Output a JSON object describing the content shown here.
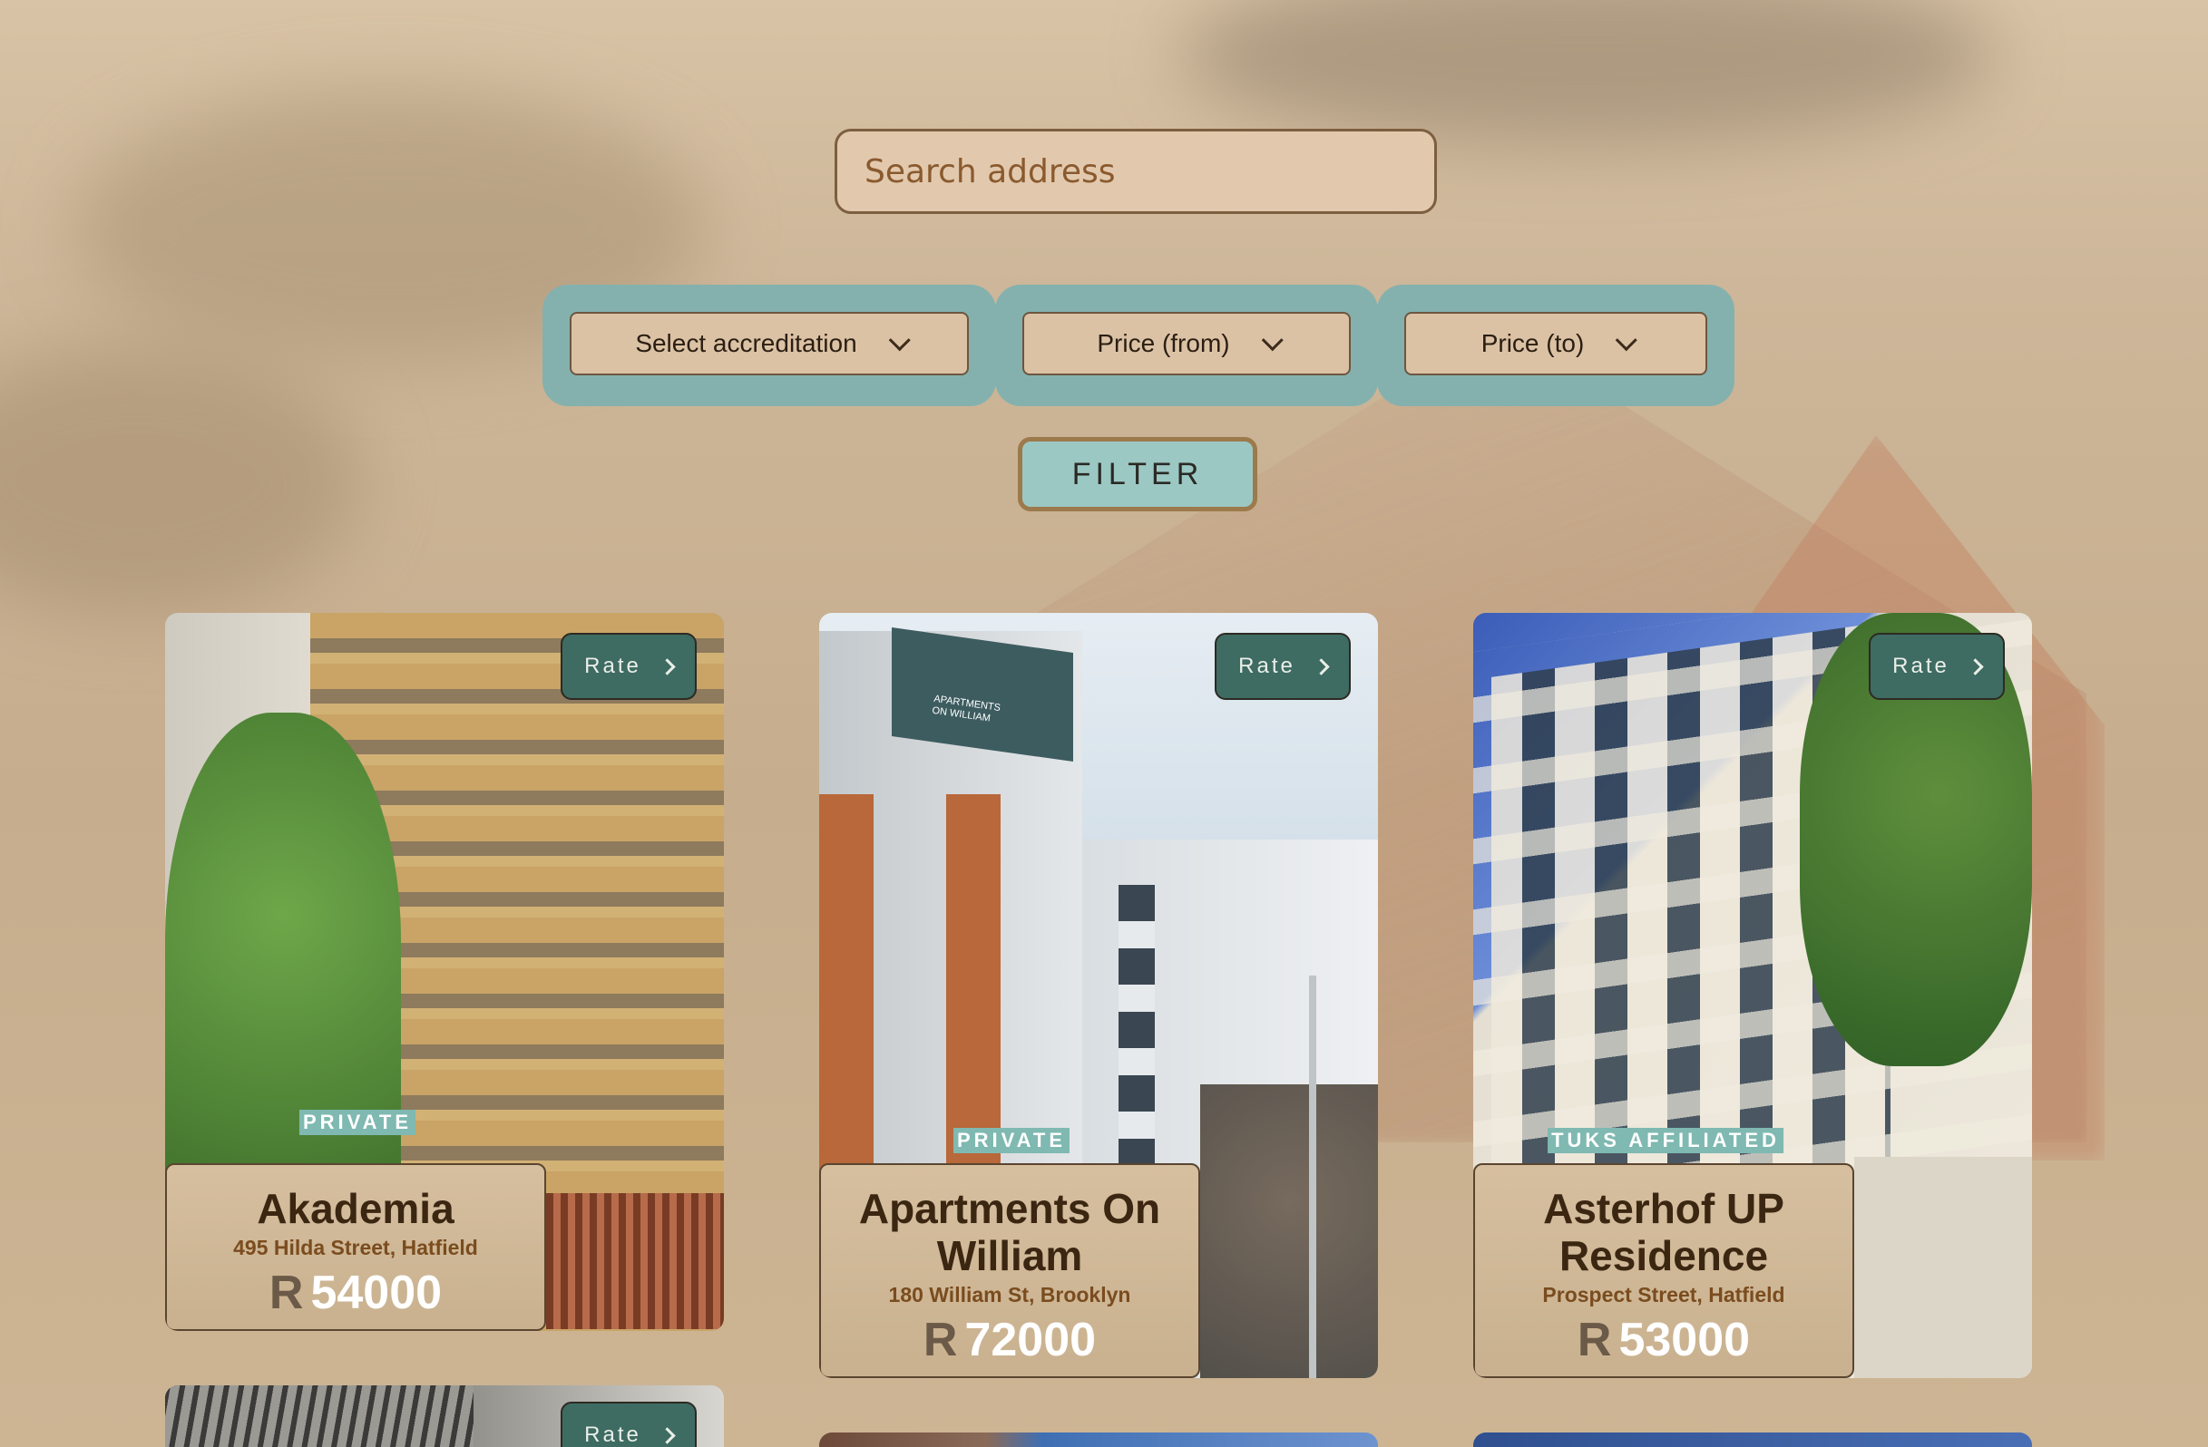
{
  "search": {
    "placeholder": "Search address"
  },
  "filters": {
    "accreditation": "Select accreditation",
    "price_from": "Price (from)",
    "price_to": "Price (to)"
  },
  "filter_button": "FILTER",
  "listings": [
    {
      "name": "Akademia",
      "address": "495 Hilda Street, Hatfield",
      "currency": "R",
      "price": "54000",
      "type": "PRIVATE",
      "rate_label": "Rate"
    },
    {
      "name": "Apartments On William",
      "address": "180 William St, Brooklyn",
      "currency": "R",
      "price": "72000",
      "type": "PRIVATE",
      "rate_label": "Rate",
      "sign_text": "APARTMENTS ON WILLIAM"
    },
    {
      "name": "Asterhof UP Residence",
      "address": "Prospect Street, Hatfield",
      "currency": "R",
      "price": "53000",
      "type": "TUKS AFFILIATED",
      "rate_label": "Rate"
    },
    {
      "rate_label": "Rate"
    }
  ],
  "colors": {
    "accent": "#84b1ae",
    "rate_button": "#3e6b62",
    "text_brown": "#3b2612",
    "badge": "#7fb9b1"
  }
}
